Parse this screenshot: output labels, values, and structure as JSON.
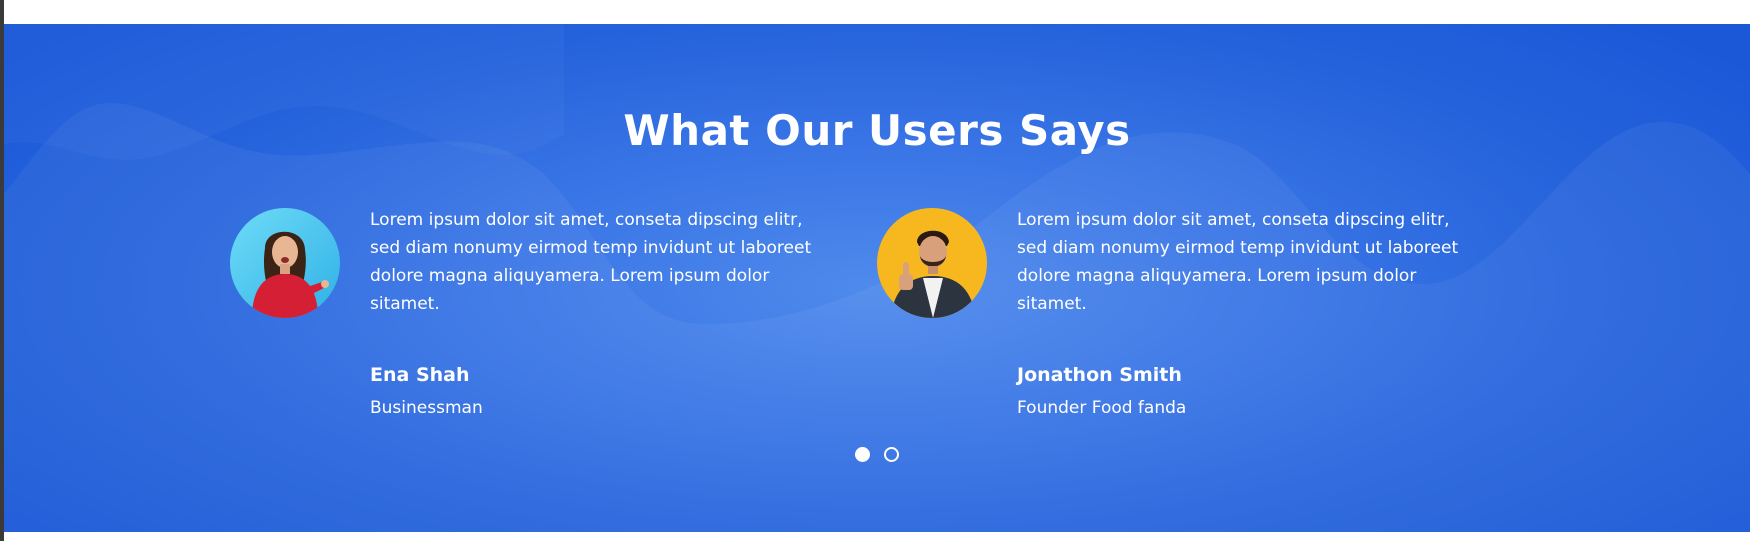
{
  "section": {
    "title": "What Our Users Says"
  },
  "testimonials": [
    {
      "quote": "Lorem ipsum dolor sit amet, conseta dipscing elitr, sed diam nonumy eirmod temp invidunt ut laboreet dolore magna aliquyamera. Lorem ipsum dolor sitamet.",
      "name": "Ena Shah",
      "role": "Businessman",
      "avatar_icon": "woman-pointing-avatar",
      "avatar_bg": "#4fc8f0"
    },
    {
      "quote": "Lorem ipsum dolor sit amet, conseta dipscing elitr, sed diam nonumy eirmod temp invidunt ut laboreet dolore magna aliquyamera. Lorem ipsum dolor sitamet.",
      "name": "Jonathon Smith",
      "role": "Founder Food fanda",
      "avatar_icon": "man-thumbs-up-avatar",
      "avatar_bg": "#f7b81f"
    }
  ],
  "carousel": {
    "slide_count": 2,
    "active_index": 0
  },
  "colors": {
    "section_bg": "#2563dc",
    "text": "#ffffff"
  }
}
